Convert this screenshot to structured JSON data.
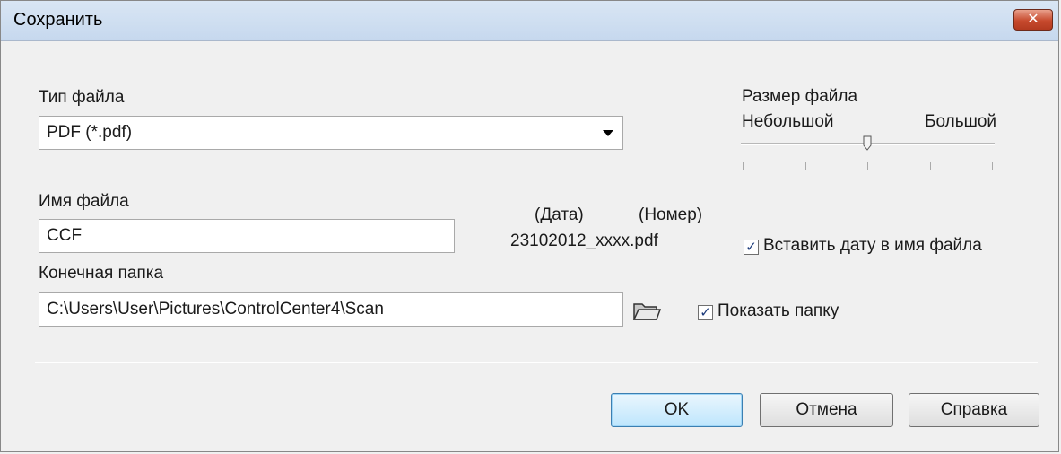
{
  "window": {
    "title": "Сохранить",
    "close_glyph": "✕"
  },
  "file_type": {
    "label": "Тип файла",
    "selected": "PDF (*.pdf)"
  },
  "file_size": {
    "label": "Размер файла",
    "min_label": "Небольшой",
    "max_label": "Большой",
    "level": 0.5
  },
  "file_name": {
    "label": "Имя файла",
    "value": "CCF"
  },
  "preview": {
    "date_label": "(Дата)",
    "number_label": "(Номер)",
    "example": "23102012_xxxx.pdf"
  },
  "insert_date": {
    "label": "Вставить дату в имя файла",
    "checked": true
  },
  "dest_folder": {
    "label": "Конечная папка",
    "value": "C:\\Users\\User\\Pictures\\ControlCenter4\\Scan",
    "browse_icon": "folder-open-icon"
  },
  "show_folder": {
    "label": "Показать папку",
    "checked": true
  },
  "buttons": {
    "ok": "OK",
    "cancel": "Отмена",
    "help": "Справка"
  }
}
